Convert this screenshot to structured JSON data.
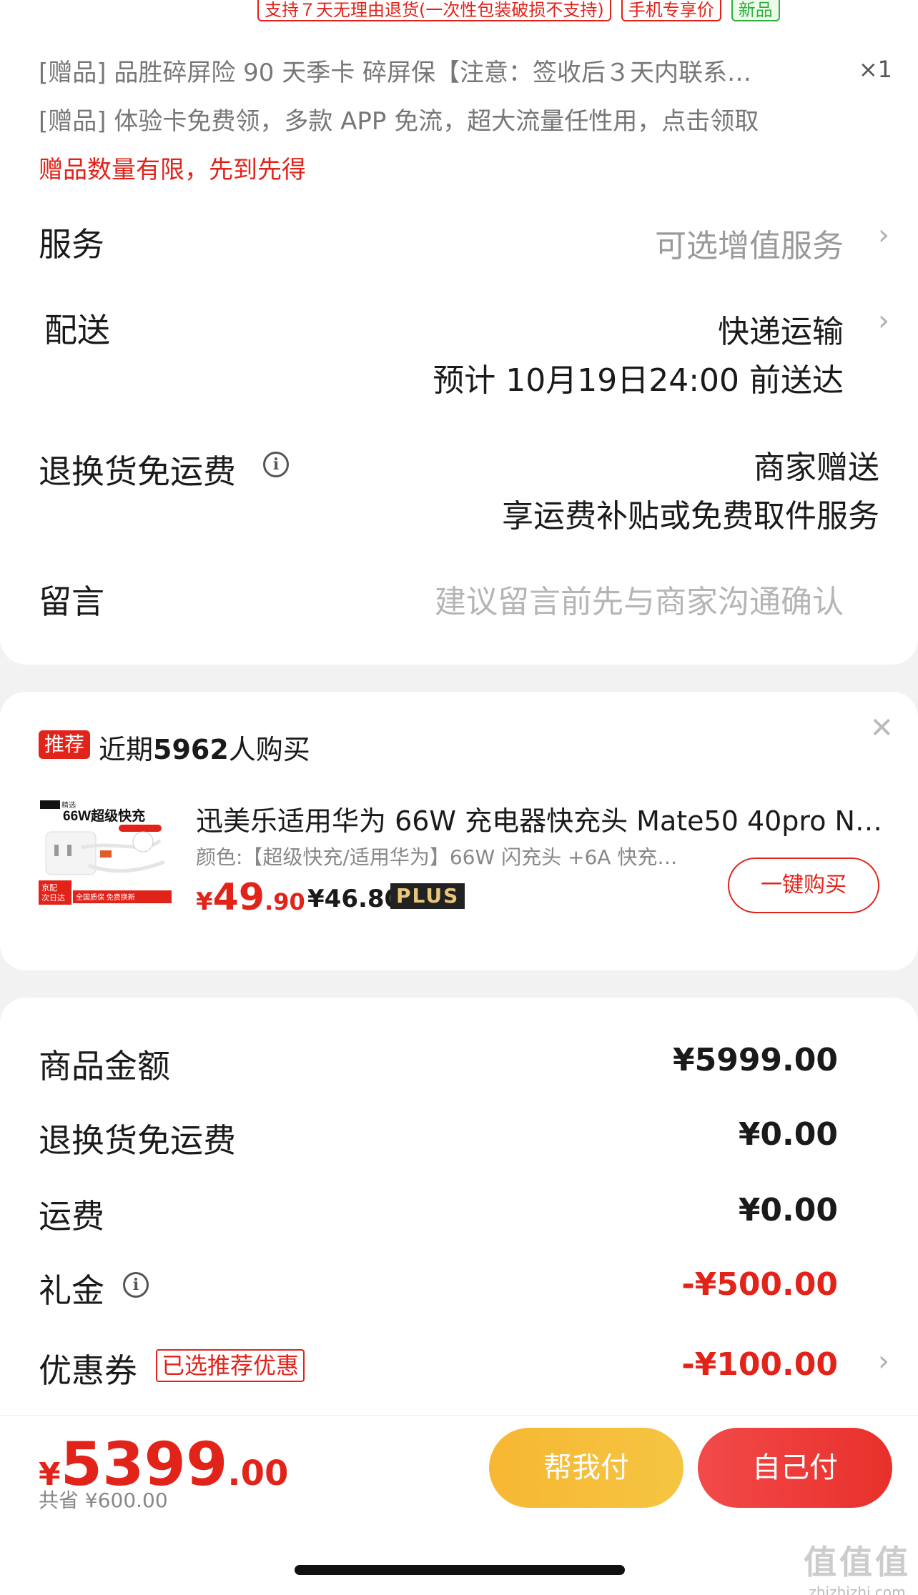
{
  "tags": [
    "支持７天无理由退货(一次性包装破损不支持)",
    "手机专享价",
    "新品"
  ],
  "gifts": {
    "line1": "[赠品] 品胜碎屏险 90 天季卡 碎屏保【注意：签收后３天内联系…",
    "qty": "×1",
    "line2": "[赠品] 体验卡免费领，多款 APP 免流，超大流量任性用，点击领取",
    "limit": "赠品数量有限，先到先得"
  },
  "service": {
    "label": "服务",
    "value": "可选增值服务"
  },
  "delivery": {
    "label": "配送",
    "method": "快递运输",
    "eta": "预计 10月19日24:00 前送达"
  },
  "return_shipping": {
    "label": "退换货免运费",
    "value1": "商家赠送",
    "value2": "享运费补贴或免费取件服务"
  },
  "message": {
    "label": "留言",
    "placeholder": "建议留言前先与商家沟通确认"
  },
  "recommend": {
    "badge": "推荐",
    "title_pre": "近期",
    "title_count": "5962",
    "title_post": "人购买",
    "product_name": "迅美乐适用华为 66W 充电器快充头 Mate50 40pro N…",
    "product_attr": "颜色:【超级快充/适用华为】66W 闪充头 +6A 快充…",
    "price_cur": "¥",
    "price_int": "49",
    "price_dec": ".90",
    "plus_price": "¥46.80",
    "plus_label": "PLUS",
    "buy_label": "一键购买",
    "img_text1": "66W超级快充",
    "img_text2": "京配\n次日达",
    "img_text3": "全国质保 免费换新",
    "img_text4": "精选"
  },
  "summary": {
    "goods_label": "商品金额",
    "goods_val": "¥5999.00",
    "return_label": "退换货免运费",
    "return_val": "¥0.00",
    "freight_label": "运费",
    "freight_val": "¥0.00",
    "gift_label": "礼金",
    "gift_val": "-¥500.00",
    "coupon_label": "优惠券",
    "coupon_tag": "已选推荐优惠",
    "coupon_val": "-¥100.00"
  },
  "footer": {
    "total_cur": "¥",
    "total_int": "5399",
    "total_dec": ".00",
    "saved": "共省 ¥600.00",
    "help_pay": "帮我付",
    "self_pay": "自己付"
  },
  "watermark": {
    "big": "值值值",
    "small": "zhizhizhi.com"
  },
  "colors": {
    "accent": "#e2231a",
    "help_btn": "#f5c542",
    "self_btn": "#e8302a"
  }
}
